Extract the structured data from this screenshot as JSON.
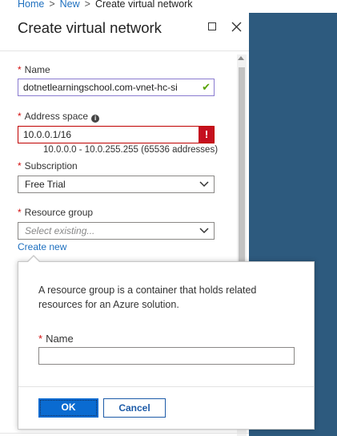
{
  "breadcrumb": {
    "items": [
      "Home",
      "New"
    ],
    "current": "Create virtual network",
    "separator": ">"
  },
  "blade": {
    "title": "Create virtual network",
    "fields": {
      "name": {
        "label": "Name",
        "value": "dotnetlearningschool.com-vnet-hc-si",
        "status_icon": "check-icon"
      },
      "address_space": {
        "label": "Address space",
        "value": "10.0.0.1/16",
        "error_icon": "!",
        "hint": "10.0.0.0 - 10.0.255.255 (65536 addresses)"
      },
      "subscription": {
        "label": "Subscription",
        "value": "Free Trial"
      },
      "resource_group": {
        "label": "Resource group",
        "placeholder": "Select existing...",
        "create_new": "Create new"
      }
    },
    "required_marker": "*"
  },
  "popup": {
    "description": "A resource group is a container that holds related resources for an Azure solution.",
    "name_label": "Name",
    "name_value": "",
    "ok_label": "OK",
    "cancel_label": "Cancel"
  },
  "colors": {
    "accent": "#0a6bd1",
    "error": "#c50f1f",
    "valid": "#57a300",
    "sidebar": "#2d5a7e"
  }
}
